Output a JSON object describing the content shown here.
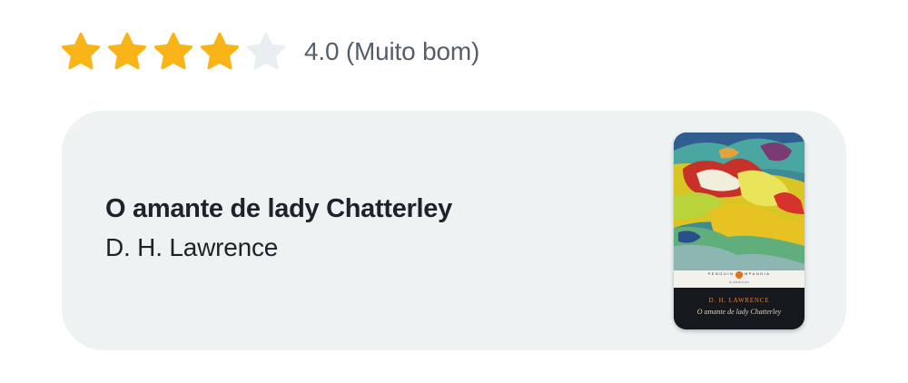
{
  "rating": {
    "value": 4.0,
    "max": 5,
    "filled_color": "#f9b417",
    "empty_color": "#e9eff1",
    "text": "4.0 (Muito bom)"
  },
  "book": {
    "title": "O amante de lady Chatterley",
    "author": "D. H. Lawrence",
    "cover": {
      "publisher": "PENGUIN  COMPANHIA",
      "series": "CLÁSSICOS",
      "author": "D. H. LAWRENCE",
      "title": "O amante de lady Chatterley"
    }
  }
}
